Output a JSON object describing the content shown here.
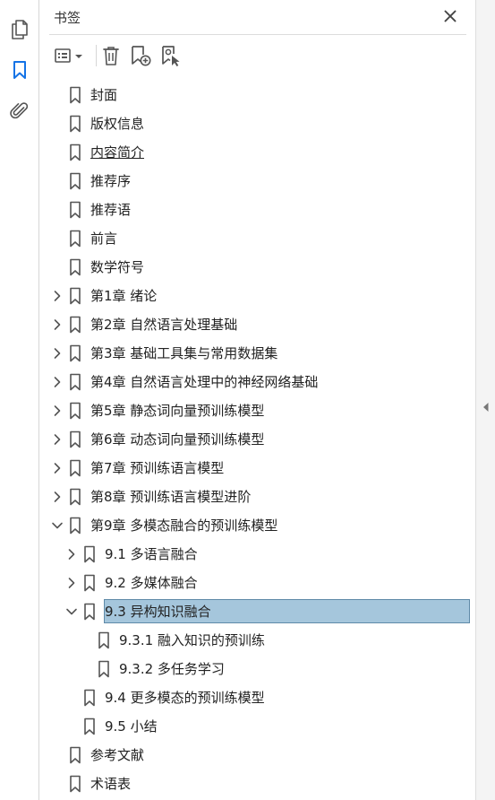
{
  "rail": {
    "items": [
      {
        "name": "pages",
        "icon": "pages-icon"
      },
      {
        "name": "bookmarks",
        "icon": "bookmark-icon",
        "active": true
      },
      {
        "name": "attachments",
        "icon": "paperclip-icon"
      }
    ]
  },
  "panel": {
    "title": "书签",
    "close_icon": "close-icon"
  },
  "toolbar": {
    "options_icon": "options-menu-icon",
    "delete_icon": "trash-icon",
    "new_bookmark_icon": "new-bookmark-icon",
    "bookmark_from_selection_icon": "bookmark-from-selection-icon"
  },
  "tree": {
    "items": [
      {
        "label": "封面",
        "level": 0,
        "expander": "none"
      },
      {
        "label": "版权信息",
        "level": 0,
        "expander": "none"
      },
      {
        "label": "内容简介",
        "level": 0,
        "expander": "none",
        "underlined": true
      },
      {
        "label": "推荐序",
        "level": 0,
        "expander": "none"
      },
      {
        "label": "推荐语",
        "level": 0,
        "expander": "none"
      },
      {
        "label": "前言",
        "level": 0,
        "expander": "none"
      },
      {
        "label": "数学符号",
        "level": 0,
        "expander": "none"
      },
      {
        "label": "第1章 绪论",
        "level": 0,
        "expander": "collapsed"
      },
      {
        "label": "第2章 自然语言处理基础",
        "level": 0,
        "expander": "collapsed"
      },
      {
        "label": "第3章 基础工具集与常用数据集",
        "level": 0,
        "expander": "collapsed"
      },
      {
        "label": "第4章 自然语言处理中的神经网络基础",
        "level": 0,
        "expander": "collapsed"
      },
      {
        "label": "第5章 静态词向量预训练模型",
        "level": 0,
        "expander": "collapsed"
      },
      {
        "label": "第6章 动态词向量预训练模型",
        "level": 0,
        "expander": "collapsed"
      },
      {
        "label": "第7章 预训练语言模型",
        "level": 0,
        "expander": "collapsed"
      },
      {
        "label": "第8章 预训练语言模型进阶",
        "level": 0,
        "expander": "collapsed"
      },
      {
        "label": "第9章 多模态融合的预训练模型",
        "level": 0,
        "expander": "expanded"
      },
      {
        "label": "9.1 多语言融合",
        "level": 1,
        "expander": "collapsed"
      },
      {
        "label": "9.2 多媒体融合",
        "level": 1,
        "expander": "collapsed"
      },
      {
        "label": "9.3 异构知识融合",
        "level": 1,
        "expander": "expanded",
        "selected": true
      },
      {
        "label": "9.3.1 融入知识的预训练",
        "level": 2,
        "expander": "none"
      },
      {
        "label": "9.3.2 多任务学习",
        "level": 2,
        "expander": "none"
      },
      {
        "label": "9.4 更多模态的预训练模型",
        "level": 1,
        "expander": "none"
      },
      {
        "label": "9.5 小结",
        "level": 1,
        "expander": "none"
      },
      {
        "label": "参考文献",
        "level": 0,
        "expander": "none"
      },
      {
        "label": "术语表",
        "level": 0,
        "expander": "none"
      }
    ]
  },
  "colors": {
    "accent": "#1473e6",
    "selection_bg": "#a5c6dc",
    "selection_border": "#5f8aa8",
    "icon": "#555555",
    "text": "#222222"
  }
}
